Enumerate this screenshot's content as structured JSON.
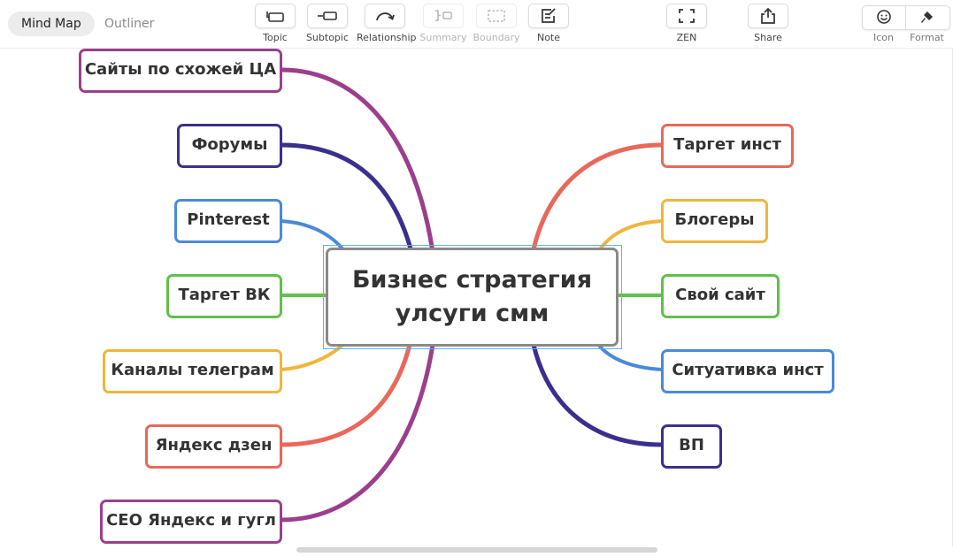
{
  "view_tabs": {
    "mind_map": "Mind Map",
    "outliner": "Outliner"
  },
  "toolbar": {
    "topic": "Topic",
    "subtopic": "Subtopic",
    "relationship": "Relationship",
    "summary": "Summary",
    "boundary": "Boundary",
    "note": "Note",
    "zen": "ZEN",
    "share": "Share",
    "icon": "Icon",
    "format": "Format"
  },
  "icons": {
    "topic": "topic-icon",
    "subtopic": "subtopic-icon",
    "relationship": "relationship-icon",
    "summary": "summary-icon",
    "boundary": "boundary-icon",
    "note": "note-icon",
    "zen": "zen-icon",
    "share": "share-icon",
    "icon": "smiley-icon",
    "format": "format-brush-icon"
  },
  "colors": {
    "purple": "#9b3f8c",
    "indigo": "#3b2f8d",
    "blue": "#4a8ad8",
    "green": "#5fc04c",
    "yellow": "#f1b53c",
    "red": "#e8685a",
    "central_border": "#8a8a8a",
    "selection": "#5ab4f0"
  },
  "central": {
    "line1": "Бизнес стратегия",
    "line2": "улсуги смм"
  },
  "left_topics": [
    "Сайты по схожей ЦА",
    "Форумы",
    "Pinterest",
    "Таргет ВК",
    "Каналы телеграм",
    "Яндекс дзен",
    "СЕО Яндекс и гугл"
  ],
  "right_topics": [
    "Таргет инст",
    "Блогеры",
    "Свой сайт",
    "Ситуативка инст",
    "ВП"
  ]
}
